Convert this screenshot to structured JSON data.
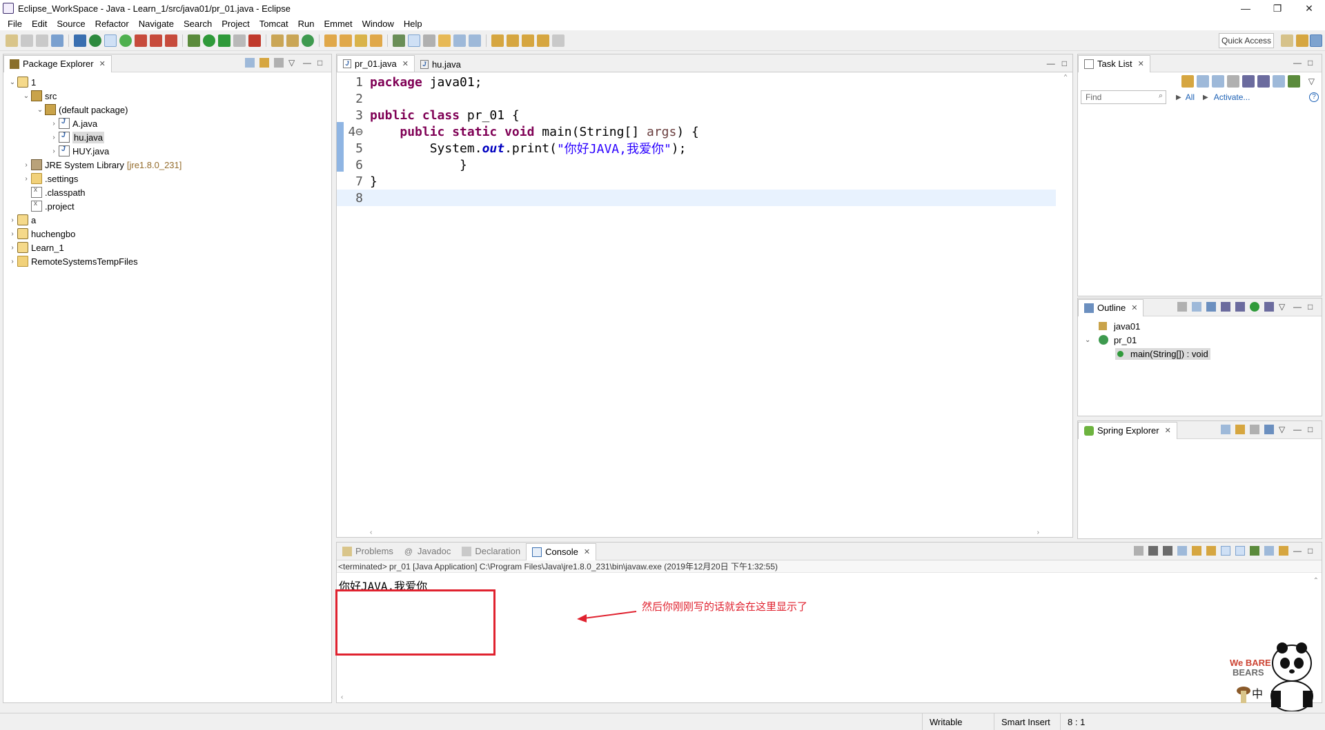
{
  "window": {
    "title": "Eclipse_WorkSpace - Java - Learn_1/src/java01/pr_01.java - Eclipse"
  },
  "menu": [
    "File",
    "Edit",
    "Source",
    "Refactor",
    "Navigate",
    "Search",
    "Project",
    "Tomcat",
    "Run",
    "Emmet",
    "Window",
    "Help"
  ],
  "toolbar": {
    "quick_access": "Quick Access"
  },
  "package_explorer": {
    "title": "Package Explorer",
    "nodes": [
      {
        "label": "1",
        "deco": ""
      },
      {
        "label": "src",
        "deco": ""
      },
      {
        "label": "(default package)",
        "deco": ""
      },
      {
        "label": "A.java",
        "deco": ""
      },
      {
        "label": "hu.java",
        "deco": ""
      },
      {
        "label": "HUY.java",
        "deco": ""
      },
      {
        "label": "JRE System Library",
        "deco": "[jre1.8.0_231]"
      },
      {
        "label": ".settings",
        "deco": ""
      },
      {
        "label": ".classpath",
        "deco": ""
      },
      {
        "label": ".project",
        "deco": ""
      },
      {
        "label": "a",
        "deco": ""
      },
      {
        "label": "huchengbo",
        "deco": ""
      },
      {
        "label": "Learn_1",
        "deco": ""
      },
      {
        "label": "RemoteSystemsTempFiles",
        "deco": ""
      }
    ]
  },
  "editor": {
    "tabs": [
      {
        "label": "pr_01.java"
      },
      {
        "label": "hu.java"
      }
    ],
    "lines": [
      {
        "no": "1",
        "parts": [
          {
            "t": "package",
            "c": "kw"
          },
          {
            "t": " java01;",
            "c": ""
          }
        ]
      },
      {
        "no": "2",
        "parts": []
      },
      {
        "no": "3",
        "parts": [
          {
            "t": "public class",
            "c": "kw"
          },
          {
            "t": " pr_01 {",
            "c": ""
          }
        ]
      },
      {
        "no": "4⊖",
        "parts": [
          {
            "t": "    ",
            "c": ""
          },
          {
            "t": "public static void",
            "c": "kw"
          },
          {
            "t": " main(String[] ",
            "c": ""
          },
          {
            "t": "args",
            "c": "param"
          },
          {
            "t": ") {",
            "c": ""
          }
        ]
      },
      {
        "no": "5",
        "parts": [
          {
            "t": "        System.",
            "c": ""
          },
          {
            "t": "out",
            "c": "field"
          },
          {
            "t": ".print(",
            "c": ""
          },
          {
            "t": "\"你好JAVA,我爱你\"",
            "c": "str"
          },
          {
            "t": ");",
            "c": ""
          }
        ]
      },
      {
        "no": "6",
        "parts": [
          {
            "t": "            }",
            "c": ""
          }
        ]
      },
      {
        "no": "7",
        "parts": [
          {
            "t": "}",
            "c": ""
          }
        ]
      },
      {
        "no": "8",
        "parts": []
      }
    ]
  },
  "task_list": {
    "title": "Task List",
    "find_placeholder": "Find",
    "all_label": "All",
    "activate_label": "Activate..."
  },
  "outline": {
    "title": "Outline",
    "items": [
      {
        "label": "java01"
      },
      {
        "label": "pr_01"
      },
      {
        "label": "main(String[]) : void"
      }
    ]
  },
  "spring_explorer": {
    "title": "Spring Explorer"
  },
  "bottom_tabs": [
    {
      "label": "Problems"
    },
    {
      "label": "Javadoc"
    },
    {
      "label": "Declaration"
    },
    {
      "label": "Console"
    }
  ],
  "console": {
    "terminated": "<terminated> pr_01 [Java Application] C:\\Program Files\\Java\\jre1.8.0_231\\bin\\javaw.exe (2019年12月20日 下午1:32:55)",
    "output": "你好JAVA,我爱你",
    "annotation": "然后你刚刚写的话就会在这里显示了"
  },
  "statusbar": {
    "writable": "Writable",
    "insert_mode": "Smart Insert",
    "position": "8 : 1"
  },
  "mascot": {
    "brand_line1": "We BARE",
    "brand_line2": "BEARS",
    "ime": "中"
  }
}
